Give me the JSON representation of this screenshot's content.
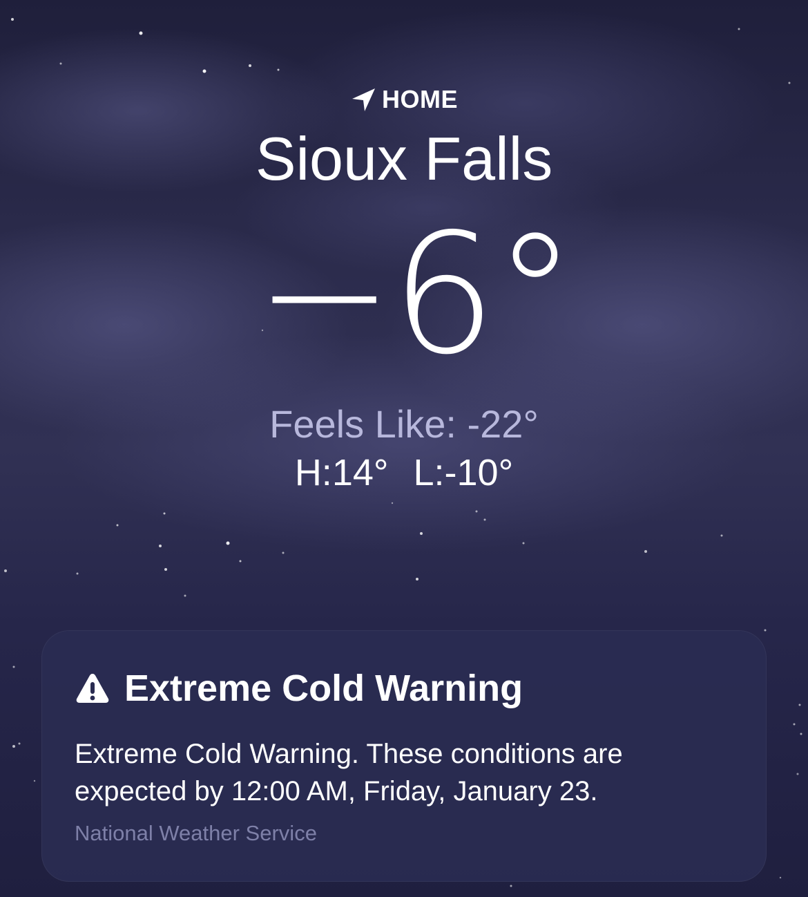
{
  "location": {
    "icon": "location-arrow-icon",
    "label": "HOME",
    "city": "Sioux Falls"
  },
  "current": {
    "temperature": "−6°",
    "feels_like": "Feels Like: -22°",
    "high": "H:14°",
    "low": "L:-10°"
  },
  "alert": {
    "icon": "warning-triangle-icon",
    "title": "Extreme Cold Warning",
    "body": "Extreme Cold Warning. These conditions are expected by 12:00 AM, Friday, January 23.",
    "source": "National Weather Service"
  },
  "colors": {
    "background": "#23233f",
    "card": "#2a2c52",
    "feels_like_text": "#b8b8dc",
    "source_text": "#7e80a8"
  }
}
